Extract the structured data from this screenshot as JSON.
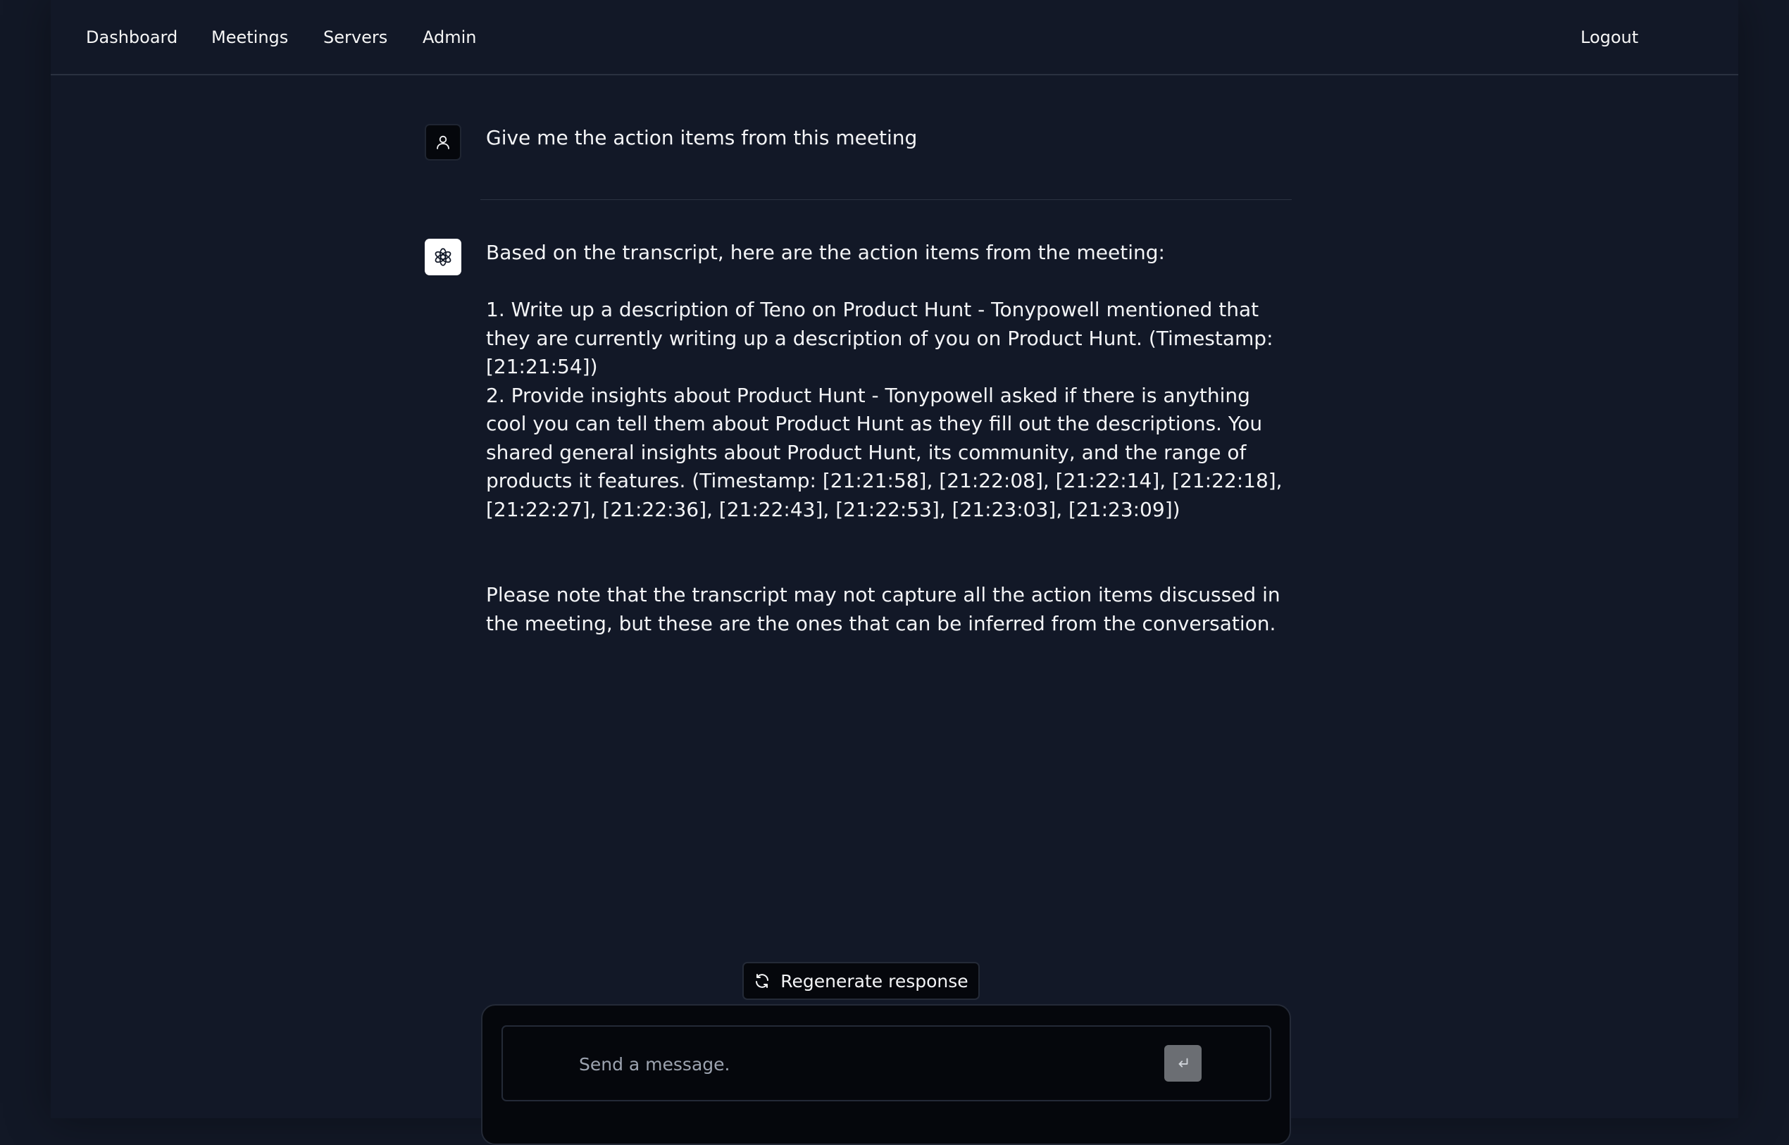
{
  "nav": {
    "links": [
      "Dashboard",
      "Meetings",
      "Servers",
      "Admin"
    ],
    "logout": "Logout"
  },
  "conversation": {
    "user_message": "Give me the action items from this meeting",
    "assistant_message": "Based on the transcript, here are the action items from the meeting:\n\n1. Write up a description of Teno on Product Hunt - Tonypowell mentioned that they are currently writing up a description of you on Product Hunt. (Timestamp: [21:21:54])\n2. Provide insights about Product Hunt - Tonypowell asked if there is anything cool you can tell them about Product Hunt as they fill out the descriptions. You shared general insights about Product Hunt, its community, and the range of products it features. (Timestamp: [21:21:58], [21:22:08], [21:22:14], [21:22:18], [21:22:27], [21:22:36], [21:22:43], [21:22:53], [21:23:03], [21:23:09])\n\n\nPlease note that the transcript may not capture all the action items discussed in the meeting, but these are the ones that can be inferred from the conversation."
  },
  "composer": {
    "regenerate_label": "Regenerate response",
    "placeholder": "Send a message.",
    "value": ""
  },
  "icons": {
    "user_avatar": "user-icon",
    "assistant_avatar": "openai-logo-icon",
    "regenerate": "refresh-icon",
    "send": "enter-icon"
  },
  "colors": {
    "background": "#121827",
    "send_button": "#6b6e73"
  }
}
